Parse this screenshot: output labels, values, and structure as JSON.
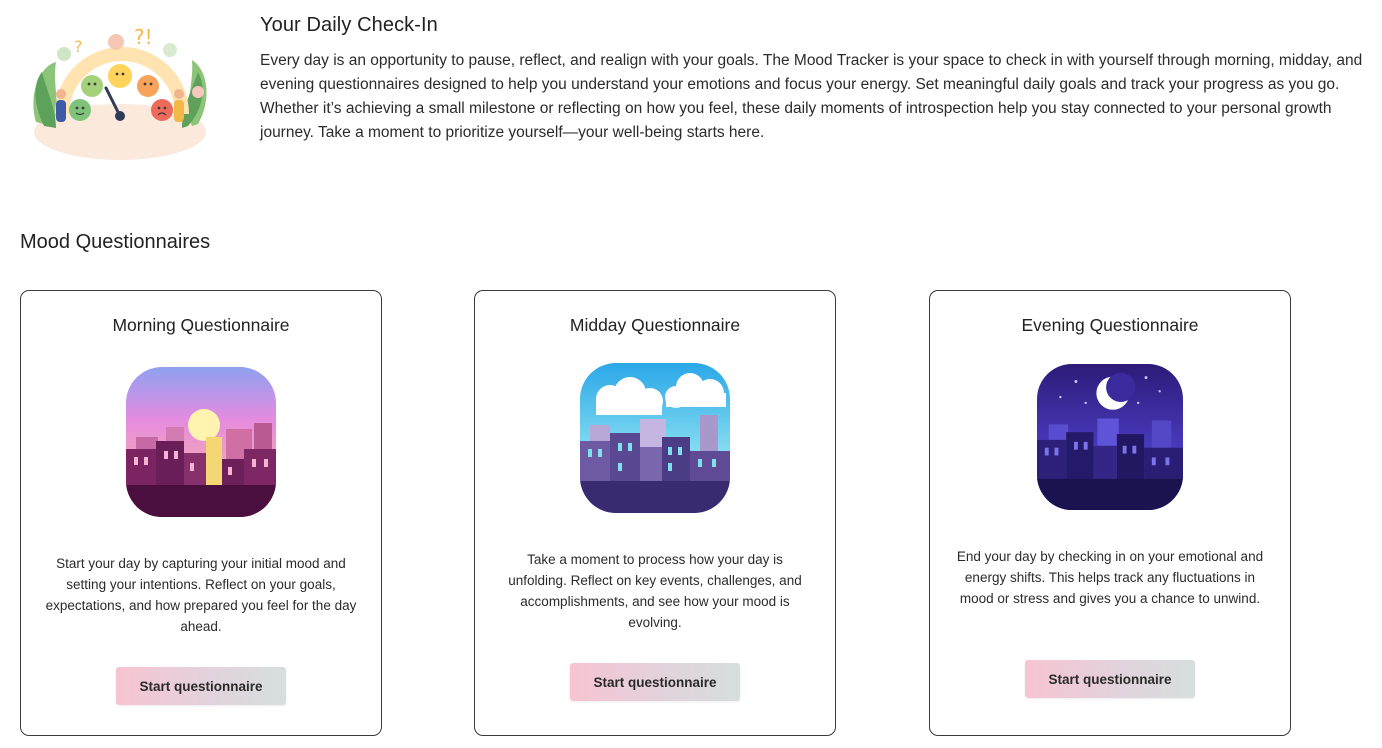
{
  "intro": {
    "title": "Your Daily Check-In",
    "body": "Every day is an opportunity to pause, reflect, and realign with your goals. The Mood Tracker is your space to check in with yourself through morning, midday, and evening questionnaires designed to help you understand your emotions and focus your energy. Set meaningful daily goals and track your progress as you go. Whether it’s achieving a small milestone or reflecting on how you feel, these daily moments of introspection help you stay connected to your personal growth journey. Take a moment to prioritize yourself—your well-being starts here."
  },
  "section": {
    "title": "Mood Questionnaires"
  },
  "cards": [
    {
      "title": "Morning Questionnaire",
      "description": "Start your day by capturing your initial mood and setting your intentions. Reflect on your goals, expectations, and how prepared you feel for the day ahead.",
      "button_label": "Start questionnaire",
      "art_icon": "sunrise-city-icon"
    },
    {
      "title": "Midday Questionnaire",
      "description": "Take a moment to process how your day is unfolding. Reflect on key events, challenges, and accomplishments, and see how your mood is evolving.",
      "button_label": "Start questionnaire",
      "art_icon": "daytime-city-icon"
    },
    {
      "title": "Evening Questionnaire",
      "description": "End your day by checking in on your emotional and energy shifts. This helps track any fluctuations in mood or stress and gives you a chance to unwind.",
      "button_label": "Start questionnaire",
      "art_icon": "night-city-icon"
    }
  ],
  "colors": {
    "button_gradient_start": "#f8c4d2",
    "button_gradient_end": "#d6dfdd",
    "card_border": "#3a3a3a"
  }
}
